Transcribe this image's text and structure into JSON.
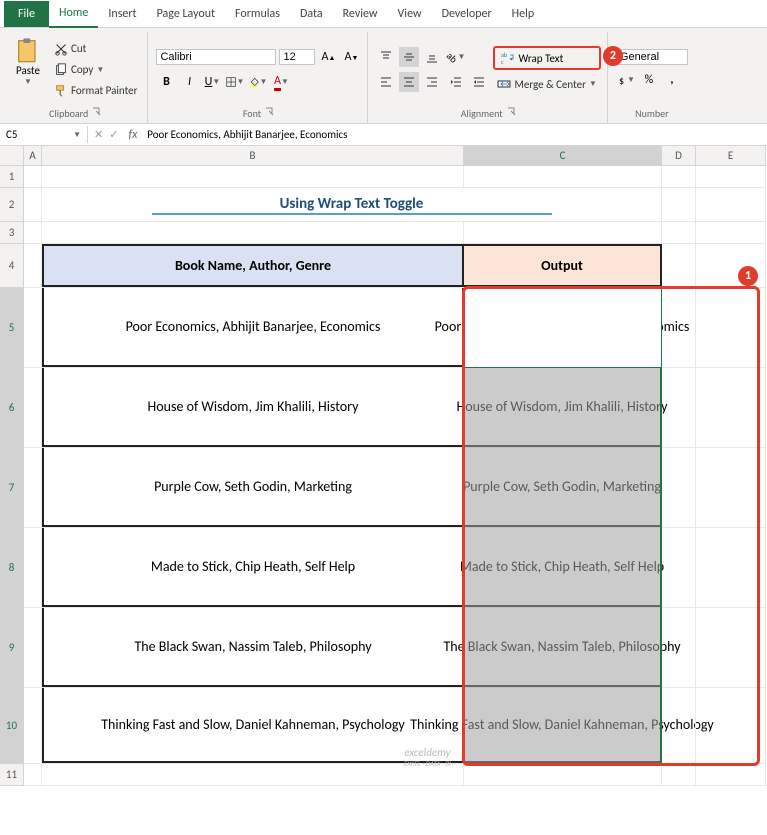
{
  "tabs": {
    "file": "File",
    "home": "Home",
    "insert": "Insert",
    "page_layout": "Page Layout",
    "formulas": "Formulas",
    "data": "Data",
    "review": "Review",
    "view": "View",
    "developer": "Developer",
    "help": "Help"
  },
  "ribbon": {
    "clipboard": {
      "paste": "Paste",
      "cut": "Cut",
      "copy": "Copy",
      "format_painter": "Format Painter",
      "label": "Clipboard"
    },
    "font": {
      "name": "Calibri",
      "size": "12",
      "label": "Font"
    },
    "alignment": {
      "wrap_text": "Wrap Text",
      "merge_center": "Merge & Center",
      "label": "Alignment"
    },
    "number": {
      "format": "General",
      "label": "Number"
    }
  },
  "namebox": "C5",
  "formula": "Poor Economics, Abhijit Banarjee, Economics",
  "columns": [
    "A",
    "B",
    "C",
    "D",
    "E"
  ],
  "rows": [
    "1",
    "2",
    "3",
    "4",
    "5",
    "6",
    "7",
    "8",
    "9",
    "10",
    "11"
  ],
  "title": "Using Wrap Text Toggle",
  "headers": {
    "b": "Book Name, Author, Genre",
    "c": "Output"
  },
  "data": [
    {
      "b": "Poor Economics, Abhijit Banarjee, Economics",
      "c": "Poor Economics, Abhijit Banarjee, Economics"
    },
    {
      "b": "House of Wisdom, Jim Khalili, History",
      "c": "House of Wisdom, Jim Khalili, History"
    },
    {
      "b": "Purple Cow, Seth Godin, Marketing",
      "c": "Purple Cow, Seth Godin, Marketing"
    },
    {
      "b": "Made to Stick, Chip Heath, Self Help",
      "c": "Made to Stick, Chip Heath, Self Help"
    },
    {
      "b": "The Black Swan, Nassim Taleb, Philosophy",
      "c": "The Black Swan, Nassim Taleb, Philosophy"
    },
    {
      "b": "Thinking Fast and Slow, Daniel Kahneman, Psychology",
      "c": "Thinking Fast and Slow, Daniel Kahneman, Psychology"
    }
  ],
  "badges": {
    "one": "1",
    "two": "2"
  },
  "watermark": {
    "main": "exceldemy",
    "sub": "EXCEL · DATA · BI"
  }
}
